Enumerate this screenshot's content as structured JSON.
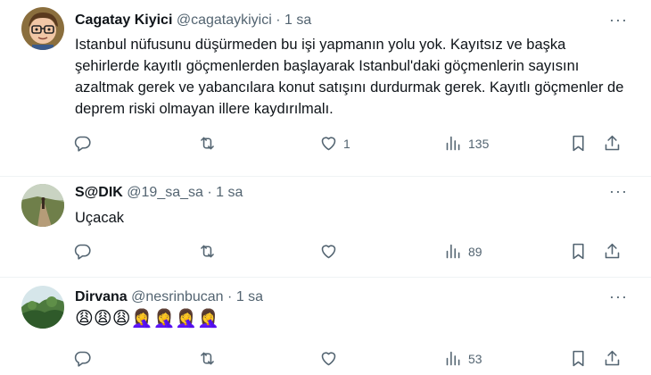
{
  "tweets": [
    {
      "name": "Cagatay Kiyici",
      "handle": "@cagataykiyici",
      "sep": "·",
      "time": "1 sa",
      "text": "Istanbul nüfusunu düşürmeden bu işi yapmanın yolu yok. Kayıtsız ve başka şehirlerde kayıtlı göçmenlerden başlayarak Istanbul'daki göçmenlerin sayısını azaltmak gerek ve yabancılara konut satışını durdurmak gerek. Kayıtlı göçmenler de deprem riski olmayan illere kaydırılmalı.",
      "likes": "1",
      "views": "135",
      "avatar": "cartoon-avatar"
    },
    {
      "name": "S@DIK",
      "handle": "@19_sa_sa",
      "sep": "·",
      "time": "1 sa",
      "text": "Uçacak",
      "likes": "",
      "views": "89",
      "avatar": "road-photo"
    },
    {
      "name": "Dirvana",
      "handle": "@nesrinbucan",
      "sep": "·",
      "time": "1 sa",
      "text": "😩😩😩🤦‍♀️🤦‍♀️🤦‍♀️🤦‍♀️",
      "likes": "",
      "views": "53",
      "avatar": "forest-photo"
    }
  ],
  "icons": {
    "more": "···",
    "reply": "reply-icon",
    "retweet": "retweet-icon",
    "like": "heart-icon",
    "views": "views-icon",
    "bookmark": "bookmark-icon",
    "share": "share-icon"
  },
  "colors": {
    "text": "#0f1419",
    "secondary": "#536471",
    "divider": "#eff3f4"
  }
}
